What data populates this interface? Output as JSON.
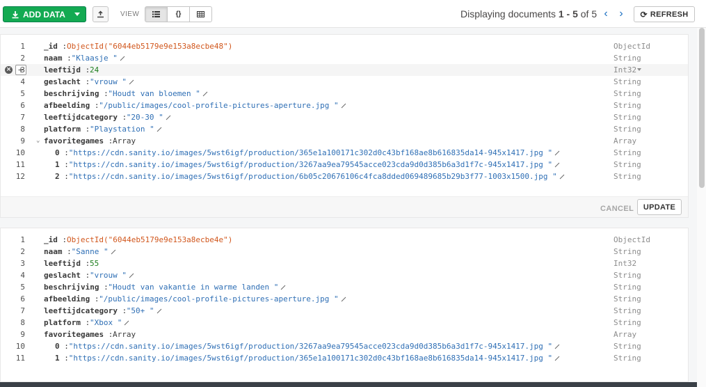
{
  "toolbar": {
    "add_data_label": "ADD DATA",
    "view_label": "VIEW",
    "view_modes": [
      "list",
      "json",
      "table"
    ],
    "paging_prefix": "Displaying documents ",
    "paging_range": "1 - 5",
    "paging_of": " of ",
    "paging_total": "5",
    "refresh_label": "REFRESH"
  },
  "colors": {
    "accent_green": "#13aa52",
    "string": "#2f6fb5",
    "number": "#1e7f1e",
    "objectid": "#d1571d"
  },
  "documents": [
    {
      "fields": [
        {
          "ln": "1",
          "key": "_id",
          "value": "ObjectId(\"6044eb5179e9e153a8ecbe48\")",
          "kind": "oid",
          "type": "ObjectId"
        },
        {
          "ln": "2",
          "key": "naam",
          "value": "\"Klaasje \"",
          "kind": "str",
          "type": "String"
        },
        {
          "ln": "3",
          "key": "leeftijd",
          "value": "24",
          "kind": "num",
          "type": "Int32",
          "hover": true
        },
        {
          "ln": "4",
          "key": "geslacht",
          "value": "\"vrouw \"",
          "kind": "str",
          "type": "String"
        },
        {
          "ln": "5",
          "key": "beschrijving",
          "value": "\"Houdt van bloemen \"",
          "kind": "str",
          "type": "String"
        },
        {
          "ln": "6",
          "key": "afbeelding",
          "value": "\"/public/images/cool-profile-pictures-aperture.jpg \"",
          "kind": "str",
          "type": "String"
        },
        {
          "ln": "7",
          "key": "leeftijdcategory",
          "value": "\"20-30 \"",
          "kind": "str",
          "type": "String"
        },
        {
          "ln": "8",
          "key": "platform",
          "value": "\"Playstation \"",
          "kind": "str",
          "type": "String"
        },
        {
          "ln": "9",
          "key": "favoritegames",
          "value": "Array",
          "kind": "arr",
          "type": "Array",
          "expanded": true
        },
        {
          "ln": "10",
          "key": "0",
          "value": "\"https://cdn.sanity.io/images/5wst6igf/production/365e1a100171c302d0c43bf168ae8b616835da14-945x1417.jpg \"",
          "kind": "str",
          "type": "String",
          "indent": true
        },
        {
          "ln": "11",
          "key": "1",
          "value": "\"https://cdn.sanity.io/images/5wst6igf/production/3267aa9ea79545acce023cda9d0d385b6a3d1f7c-945x1417.jpg \"",
          "kind": "str",
          "type": "String",
          "indent": true
        },
        {
          "ln": "12",
          "key": "2",
          "value": "\"https://cdn.sanity.io/images/5wst6igf/production/6b05c20676106c4fca8dded069489685b29b3f77-1003x1500.jpg \"",
          "kind": "str",
          "type": "String",
          "indent": true
        }
      ],
      "cancel_label": "CANCEL",
      "update_label": "UPDATE"
    },
    {
      "fields": [
        {
          "ln": "1",
          "key": "_id",
          "value": "ObjectId(\"6044eb5179e9e153a8ecbe4e\")",
          "kind": "oid",
          "type": "ObjectId"
        },
        {
          "ln": "2",
          "key": "naam",
          "value": "\"Sanne \"",
          "kind": "str",
          "type": "String"
        },
        {
          "ln": "3",
          "key": "leeftijd",
          "value": "55",
          "kind": "num",
          "type": "Int32"
        },
        {
          "ln": "4",
          "key": "geslacht",
          "value": "\"vrouw \"",
          "kind": "str",
          "type": "String"
        },
        {
          "ln": "5",
          "key": "beschrijving",
          "value": "\"Houdt van vakantie in warme landen \"",
          "kind": "str",
          "type": "String"
        },
        {
          "ln": "6",
          "key": "afbeelding",
          "value": "\"/public/images/cool-profile-pictures-aperture.jpg \"",
          "kind": "str",
          "type": "String"
        },
        {
          "ln": "7",
          "key": "leeftijdcategory",
          "value": "\"50+ \"",
          "kind": "str",
          "type": "String"
        },
        {
          "ln": "8",
          "key": "platform",
          "value": "\"Xbox \"",
          "kind": "str",
          "type": "String"
        },
        {
          "ln": "9",
          "key": "favoritegames",
          "value": "Array",
          "kind": "arr",
          "type": "Array"
        },
        {
          "ln": "10",
          "key": "0",
          "value": "\"https://cdn.sanity.io/images/5wst6igf/production/3267aa9ea79545acce023cda9d0d385b6a3d1f7c-945x1417.jpg \"",
          "kind": "str",
          "type": "String",
          "indent": true
        },
        {
          "ln": "11",
          "key": "1",
          "value": "\"https://cdn.sanity.io/images/5wst6igf/production/365e1a100171c302d0c43bf168ae8b616835da14-945x1417.jpg \"",
          "kind": "str",
          "type": "String",
          "indent": true
        }
      ],
      "cancel_label": "CANCEL",
      "update_label": "UPDATE"
    }
  ]
}
